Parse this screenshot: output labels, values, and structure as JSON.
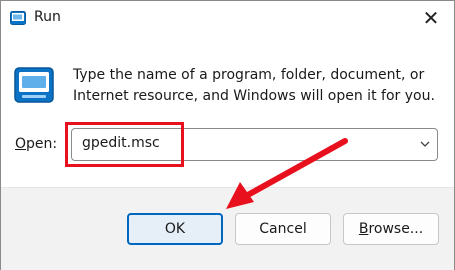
{
  "window": {
    "title": "Run",
    "close_glyph": "✕"
  },
  "content": {
    "description": "Type the name of a program, folder, document, or Internet resource, and Windows will open it for you."
  },
  "open_field": {
    "label_underlined": "O",
    "label_rest": "pen:",
    "value": "gpedit.msc"
  },
  "buttons": {
    "ok": "OK",
    "cancel": "Cancel",
    "browse_underlined": "B",
    "browse_rest": "rowse..."
  },
  "colors": {
    "annotation_red": "#e8101c",
    "accent": "#0067c0"
  },
  "icons": {
    "title": "run-app-icon",
    "large": "run-app-icon",
    "chevron": "chevron-down-icon",
    "close": "close-icon"
  }
}
